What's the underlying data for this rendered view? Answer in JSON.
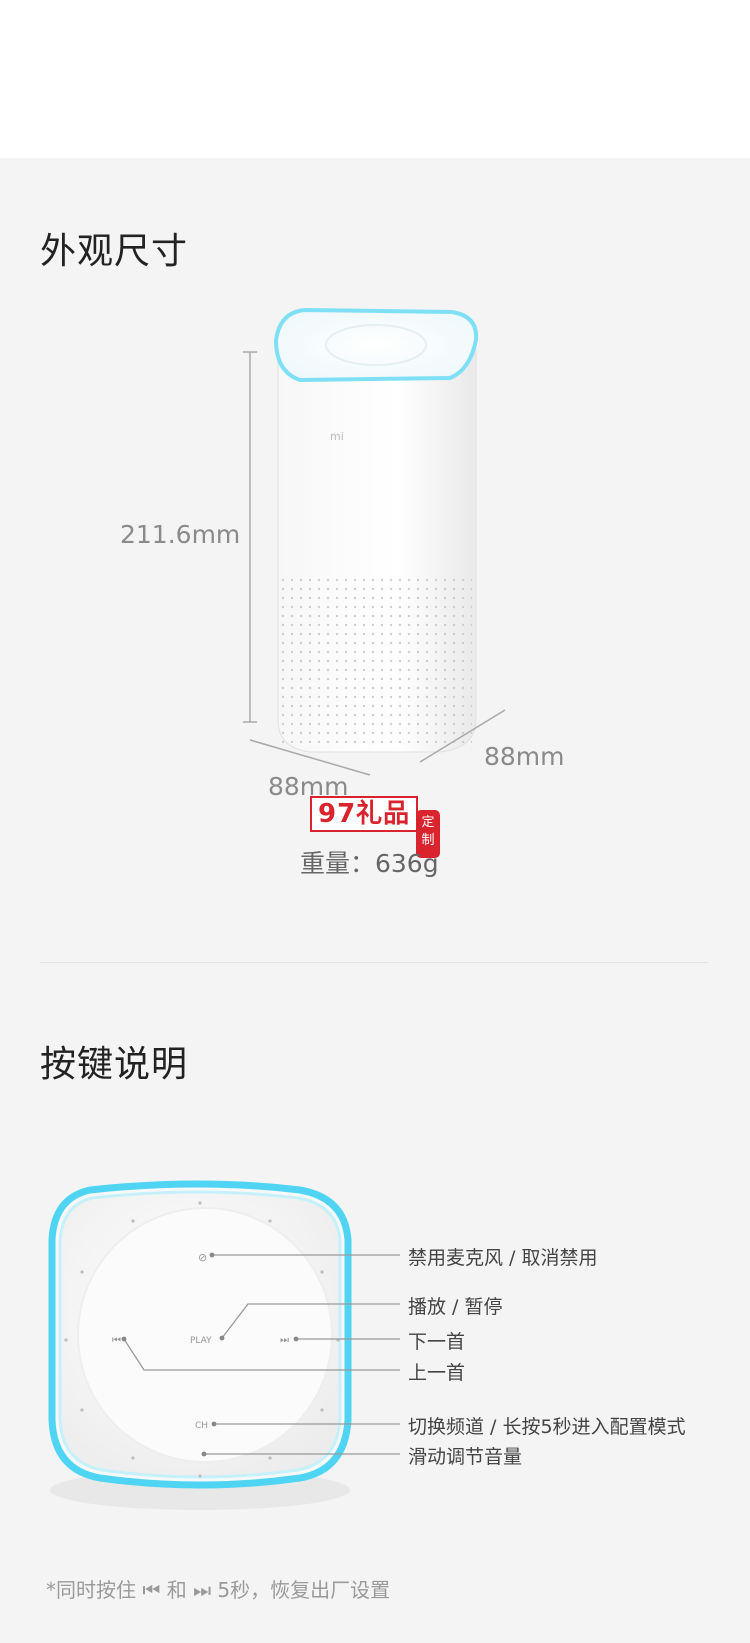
{
  "dimensions_section": {
    "title": "外观尺寸",
    "height_label": "211.6mm",
    "width_label": "88mm",
    "depth_label": "88mm",
    "weight_label": "重量：636g",
    "watermark": "97礼品",
    "seal_text": "定制",
    "brand_mark": "mi"
  },
  "buttons_section": {
    "title": "按键说明",
    "top_labels": {
      "play": "PLAY",
      "ch": "CH"
    },
    "callouts": [
      "禁用麦克风 / 取消禁用",
      "播放 / 暂停",
      "下一首",
      "上一首",
      "切换频道 / 长按5秒进入配置模式",
      "滑动调节音量"
    ],
    "footnote": "*同时按住 ⏮ 和 ⏭ 5秒，恢复出厂设置"
  },
  "colors": {
    "background": "#f4f4f4",
    "glow": "#5fd6f0",
    "text": "#444444",
    "stamp": "#d9232d"
  }
}
